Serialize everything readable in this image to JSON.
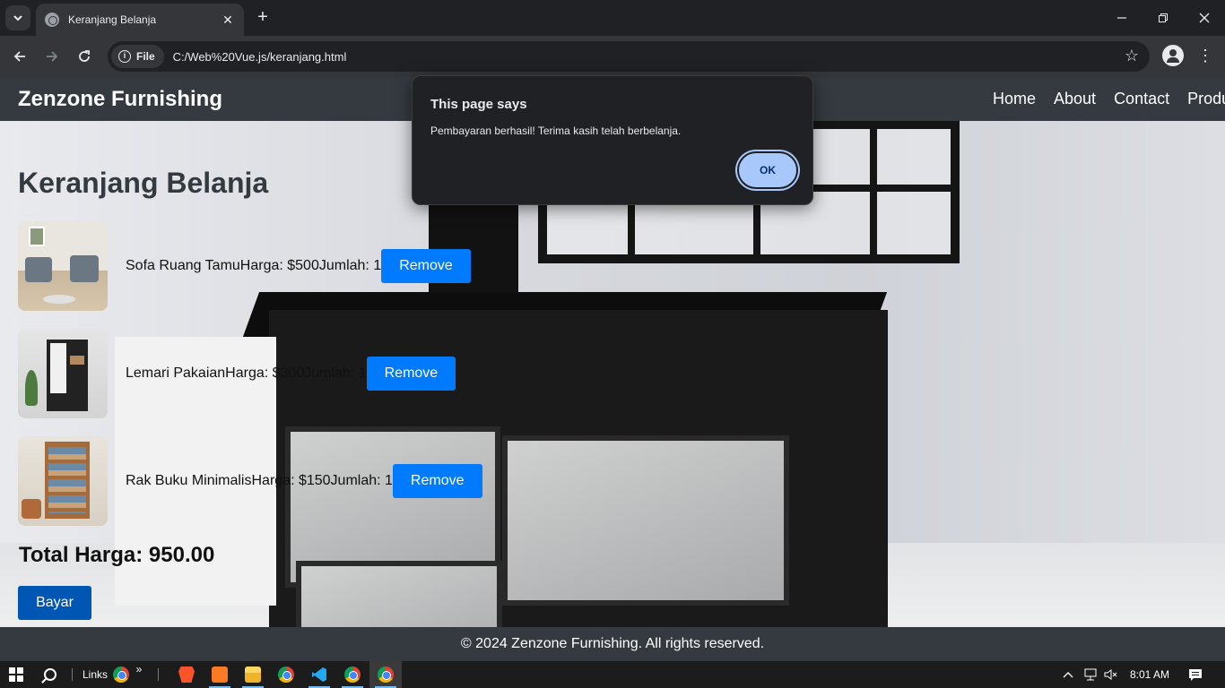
{
  "browser": {
    "tab_title": "Keranjang Belanja",
    "url_chip": "File",
    "url": "C:/Web%20Vue.js/keranjang.html"
  },
  "site": {
    "brand": "Zenzone Furnishing",
    "nav": [
      "Home",
      "About",
      "Contact",
      "Produ"
    ],
    "title": "Keranjang Belanja",
    "items": [
      {
        "text": "Sofa Ruang TamuHarga: $500Jumlah: 1",
        "remove": "Remove"
      },
      {
        "text": "Lemari PakaianHarga: $300Jumlah: 1",
        "remove": "Remove"
      },
      {
        "text": "Rak Buku MinimalisHarga: $150Jumlah: 1",
        "remove": "Remove"
      }
    ],
    "total": "Total Harga: 950.00",
    "pay_button": "Bayar",
    "footer": "© 2024 Zenzone Furnishing. All rights reserved."
  },
  "dialog": {
    "title": "This page says",
    "message": "Pembayaran berhasil! Terima kasih telah berbelanja.",
    "ok": "OK"
  },
  "taskbar": {
    "links_label": "Links",
    "chevron": "»",
    "time": "8:01 AM"
  },
  "colors": {
    "header_bg": "#343a40",
    "remove_button": "#007bff",
    "pay_button": "#0056b3",
    "dialog_ok": "#a8c7fa"
  }
}
